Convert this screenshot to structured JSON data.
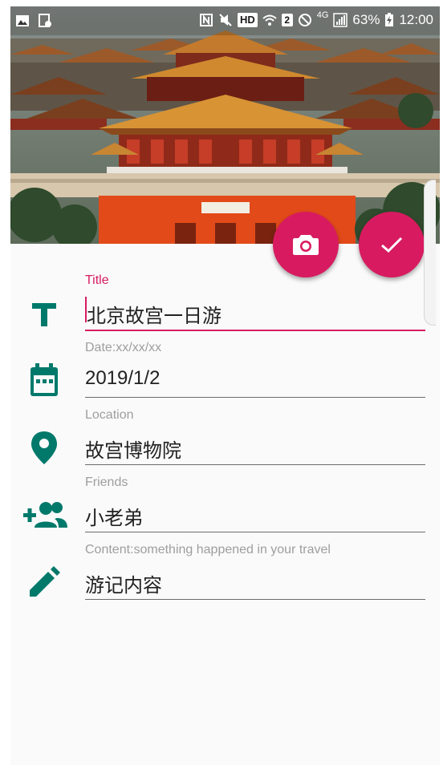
{
  "status_bar": {
    "hd": "HD",
    "sim": "2",
    "network": "4G",
    "battery": "63%",
    "time": "12:00"
  },
  "colors": {
    "accent": "#d81b60",
    "icon_teal": "#00796b",
    "label_gray": "#9e9e9e"
  },
  "form": {
    "title": {
      "label": "Title",
      "value": "北京故宫一日游",
      "icon": "text-format-icon"
    },
    "date": {
      "label": "Date:xx/xx/xx",
      "value": "2019/1/2",
      "icon": "calendar-icon"
    },
    "location": {
      "label": "Location",
      "value": "故宫博物院",
      "icon": "location-pin-icon"
    },
    "friends": {
      "label": "Friends",
      "value": "小老弟",
      "icon": "group-add-icon"
    },
    "content": {
      "label": "Content:something happened in your travel",
      "value": "游记内容",
      "icon": "edit-icon"
    }
  },
  "fabs": [
    {
      "name": "camera",
      "icon": "camera-icon"
    },
    {
      "name": "done",
      "icon": "check-icon"
    }
  ]
}
